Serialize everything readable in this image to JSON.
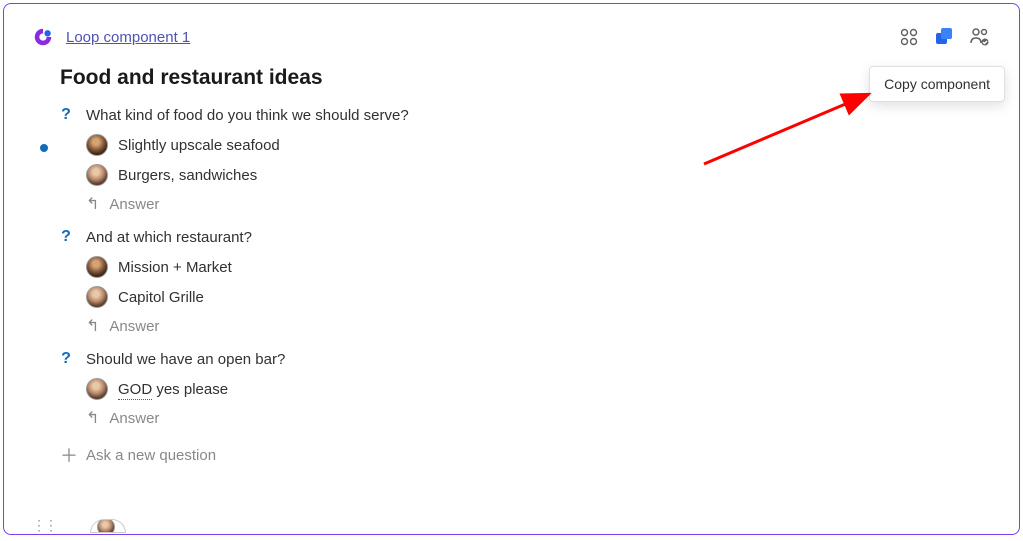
{
  "header": {
    "link_text": "Loop component 1"
  },
  "tooltip": {
    "text": "Copy component"
  },
  "section": {
    "title": "Food and restaurant ideas"
  },
  "questions": [
    {
      "text": "What kind of food do you think we should serve?",
      "answers": [
        {
          "text": "Slightly upscale seafood",
          "avatar": "avatar-1"
        },
        {
          "text": "Burgers, sandwiches",
          "avatar": "avatar-2"
        }
      ]
    },
    {
      "text": "And at which restaurant?",
      "answers": [
        {
          "text": "Mission + Market",
          "avatar": "avatar-1"
        },
        {
          "text": "Capitol Grille",
          "avatar": "avatar-2"
        }
      ]
    },
    {
      "text": "Should we have an open bar?",
      "answers": [
        {
          "text_prefix": "GOD",
          "text_suffix": " yes please",
          "avatar": "avatar-2"
        }
      ]
    }
  ],
  "labels": {
    "answer": "Answer",
    "ask_new": "Ask a new question"
  }
}
